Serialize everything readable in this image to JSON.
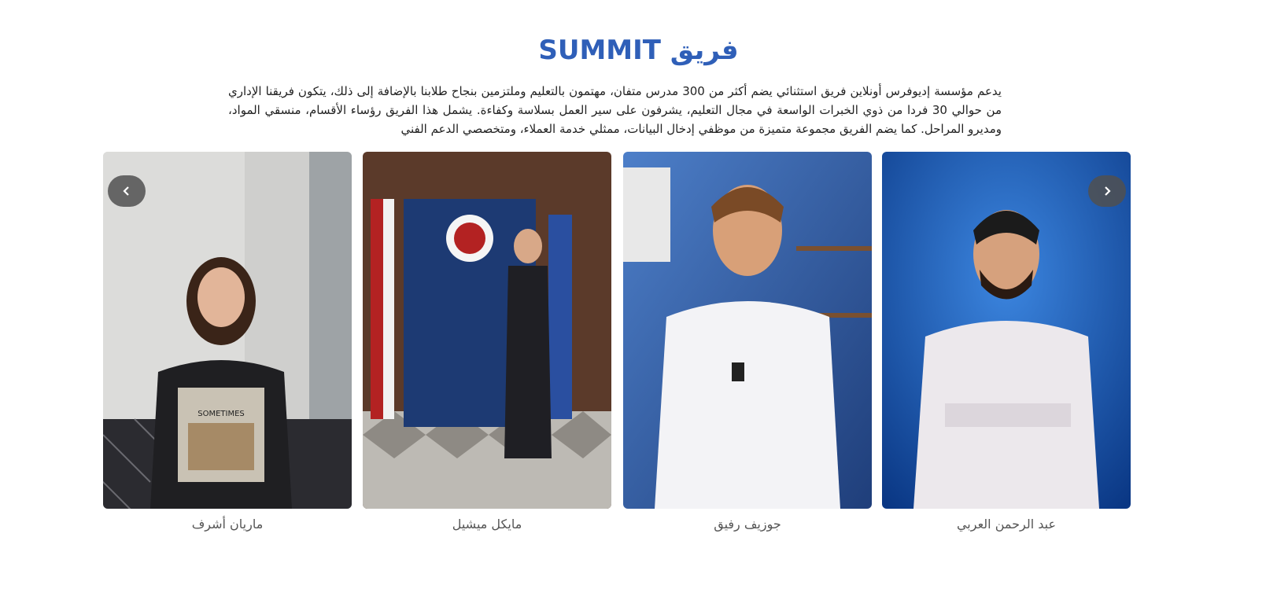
{
  "section": {
    "title": "فريق SUMMIT",
    "description": "يدعم مؤسسة إديوفرس أونلاين فريق استثنائي يضم أكثر من 300 مدرس متفان، مهتمون بالتعليم وملتزمين بنجاح طلابنا بالإضافة إلى ذلك، يتكون فريقنا الإداري من حوالي 30 فردا من ذوي الخبرات الواسعة في مجال التعليم، يشرفون على سير العمل بسلاسة وكفاءة. يشمل هذا الفريق رؤساء الأقسام، منسقي المواد، ومديرو المراحل. كما يضم الفريق مجموعة متميزة من موظفي إدخال البيانات، ممثلي خدمة العملاء، ومتخصصي الدعم الفني"
  },
  "carousel": {
    "prev_icon": "chevron-left-icon",
    "next_icon": "chevron-right-icon",
    "members": [
      {
        "name": "ماريان أشرف"
      },
      {
        "name": "مايكل ميشيل"
      },
      {
        "name": "جوزيف رفيق"
      },
      {
        "name": "عبد الرحمن العربي"
      }
    ]
  },
  "colors": {
    "title": "#2f5fb8",
    "text": "#222222",
    "name": "#555555",
    "nav": "#505050"
  }
}
